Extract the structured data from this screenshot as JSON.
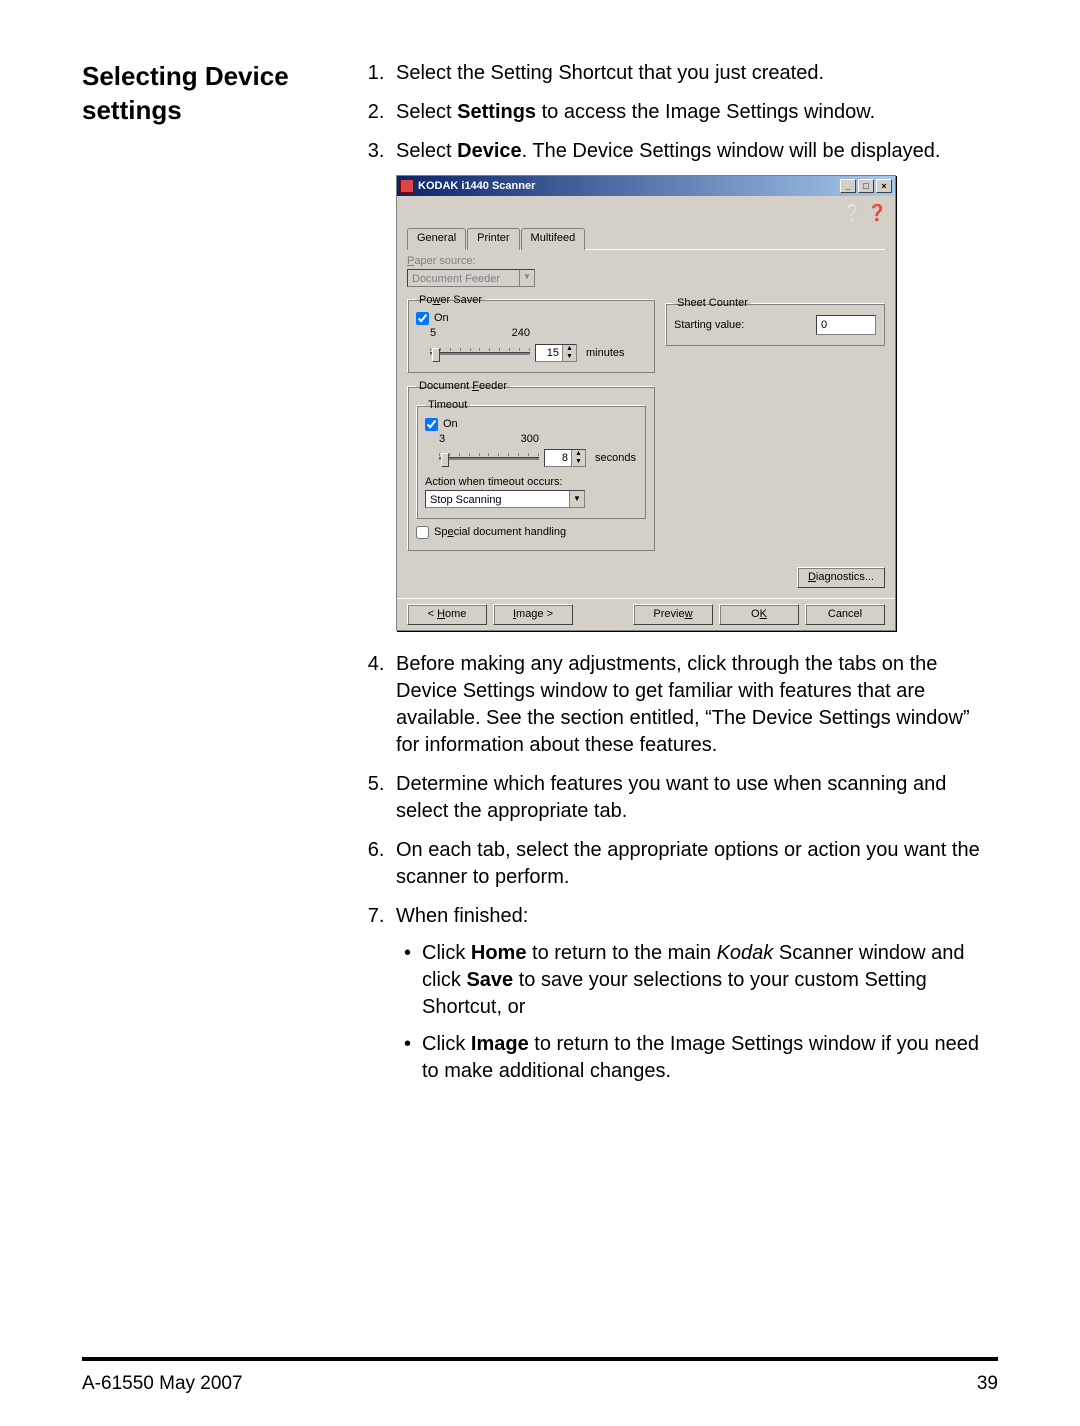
{
  "heading": "Selecting Device settings",
  "steps": {
    "s1": "Select the Setting Shortcut that you just created.",
    "s2a": "Select ",
    "s2b": "Settings",
    "s2c": " to access the Image Settings window.",
    "s3a": "Select ",
    "s3b": "Device",
    "s3c": ". The Device Settings window will be displayed.",
    "s4": "Before making any adjustments, click through the tabs on the Device Settings window to get familiar with features that are available. See the section entitled, “The Device Settings window” for information about these features.",
    "s5": "Determine which features you want to use when scanning and select the appropriate tab.",
    "s6": "On each tab, select the appropriate options or action you want the scanner to perform.",
    "s7": "When finished:",
    "b1a": "Click ",
    "b1b": "Home",
    "b1c": " to return to the main ",
    "b1d": "Kodak",
    "b1e": " Scanner window and click ",
    "b1f": "Save",
    "b1g": " to save your selections to your custom Setting Shortcut, or",
    "b2a": "Click ",
    "b2b": "Image",
    "b2c": " to return to the Image Settings window if you need to make additional changes."
  },
  "dialog": {
    "title": "KODAK i1440 Scanner",
    "tabs": {
      "general": "General",
      "printer": "Printer",
      "multifeed": "Multifeed"
    },
    "paper_source_label": "Paper source:",
    "paper_source_value": "Document Feeder",
    "power_saver": {
      "legend": "Power Saver",
      "on": "On",
      "min": "5",
      "max": "240",
      "value": "15",
      "unit": "minutes"
    },
    "doc_feeder": {
      "legend": "Document Feeder",
      "timeout_legend": "Timeout",
      "on": "On",
      "min": "3",
      "max": "300",
      "value": "8",
      "unit": "seconds",
      "action_label": "Action when timeout occurs:",
      "action_value": "Stop Scanning",
      "special": "Special document handling"
    },
    "sheet_counter": {
      "legend": "Sheet Counter",
      "starting_label": "Starting value:",
      "starting_value": "0"
    },
    "buttons": {
      "diagnostics": "Diagnostics...",
      "home": "< Home",
      "image": "Image >",
      "preview": "Preview",
      "ok": "OK",
      "cancel": "Cancel"
    }
  },
  "footer": {
    "left": "A-61550  May 2007",
    "right": "39"
  }
}
